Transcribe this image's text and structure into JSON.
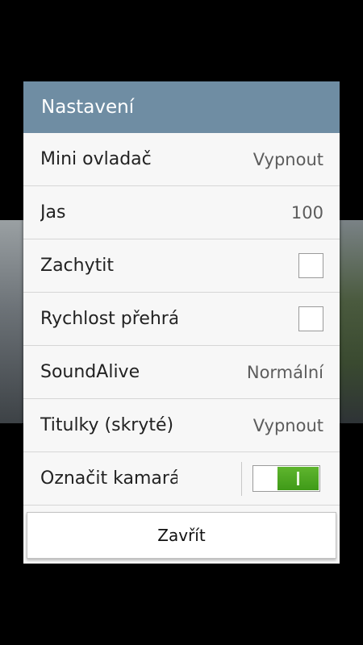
{
  "dialog": {
    "title": "Nastavení",
    "rows": [
      {
        "label": "Mini ovladač",
        "value": "Vypnout"
      },
      {
        "label": "Jas",
        "value": "100"
      },
      {
        "label": "Zachytit",
        "checked": false
      },
      {
        "label": "Rychlost přehrávání",
        "checked": false
      },
      {
        "label": "SoundAlive",
        "value": "Normální"
      },
      {
        "label": "Titulky (skryté)",
        "value": "Vypnout"
      },
      {
        "label": "Označit kamarády",
        "toggle_on": true
      }
    ],
    "close_label": "Zavřít"
  },
  "colors": {
    "header": "#6f8da3",
    "toggle_on": "#4aa620"
  }
}
